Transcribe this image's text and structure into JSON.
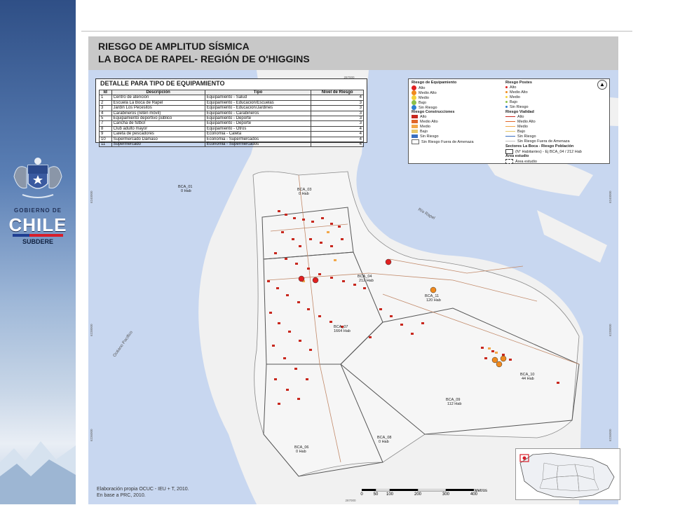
{
  "sidebar": {
    "brand_top": "GOBIERNO DE",
    "brand_main": "CHILE",
    "brand_sub": "SUBDERE"
  },
  "map": {
    "title_line1": "RIESGO DE AMPLITUD SÍSMICA",
    "title_line2": "LA BOCA DE RAPEL- REGIÓN DE O'HIGGINS",
    "coordinate_top": "287000",
    "coordinate_left_1": "6240000",
    "coordinate_left_2": "6238000",
    "coordinate_left_3": "6236000",
    "coordinate_right_1": "6240000",
    "coordinate_right_2": "6238000",
    "coordinate_right_3": "6236000",
    "coordinate_bottom": "287000",
    "water_label_ocean": "Océano Pacífico",
    "water_label_river": "Río Rapel",
    "sectors": [
      {
        "name": "BCA_01",
        "hab": "0 Hab"
      },
      {
        "name": "BCA_03",
        "hab": "0 Hab"
      },
      {
        "name": "BCA_04",
        "hab": "212 Hab"
      },
      {
        "name": "BCA_11",
        "hab": "120 Hab"
      },
      {
        "name": "BCA_07",
        "hab": "1664 Hab"
      },
      {
        "name": "BCA_10",
        "hab": "44 Hab"
      },
      {
        "name": "BCA_09",
        "hab": "112 Hab"
      },
      {
        "name": "BCA_08",
        "hab": "0 Hab"
      },
      {
        "name": "BCA_06",
        "hab": "0 Hab"
      }
    ],
    "credit_line1": "Elaboración propia OCUC - IEU + T, 2010.",
    "credit_line2": "En base a PRC, 2010.",
    "scale_unit": "Metros",
    "scale_ticks": [
      "0",
      "50",
      "100",
      "200",
      "300",
      "400"
    ]
  },
  "equip_table": {
    "title": "DETALLE PARA TIPO DE EQUIPAMIENTO",
    "headers": [
      "Id",
      "Descripción",
      "Tipo",
      "Nivel de Riesgo"
    ],
    "rows": [
      [
        "1",
        "Centro de atención",
        "Equipamiento - Salud",
        "4"
      ],
      [
        "2",
        "Escuela La Boca de Rapel",
        "Equipamiento - Educacion/Escuelas",
        "3"
      ],
      [
        "3",
        "Jardin Los Pecesitos",
        "Equipamiento - Educacion/Jardines",
        "3"
      ],
      [
        "4",
        "Carabineros (retén móvil)",
        "Equipamiento - Carabineros",
        "3"
      ],
      [
        "5",
        "Equipamiento deportivo público",
        "Equipamiento - Deporte",
        "3"
      ],
      [
        "7",
        "Cancha de fútbol",
        "Equipamiento - Deporte",
        "3"
      ],
      [
        "8",
        "Club adulto mayor",
        "Equipamiento - Otros",
        "4"
      ],
      [
        "9",
        "Caleta de pescadores",
        "Economia - Caleta",
        "4"
      ],
      [
        "10",
        "Supermercado Dámaso",
        "Economia - Supermercados",
        "4"
      ],
      [
        "11",
        "Supermercado",
        "Economia - Supermercados",
        "4"
      ]
    ]
  },
  "legend": {
    "equip_title": "Riesgo de Equipamiento",
    "equip_items": [
      {
        "label": "Alto",
        "color": "#e02020"
      },
      {
        "label": "Medio Alto",
        "color": "#f08a1e"
      },
      {
        "label": "Medio",
        "color": "#f3d23a"
      },
      {
        "label": "Bajo",
        "color": "#8cc04a"
      },
      {
        "label": "Sin Riesgo",
        "color": "#2f7fd0"
      }
    ],
    "constr_title": "Riesgo Construcciones",
    "constr_items": [
      {
        "label": "Alto",
        "color": "#c8281e"
      },
      {
        "label": "Medio Alto",
        "color": "#e0662a"
      },
      {
        "label": "Medio",
        "color": "#f2a84a"
      },
      {
        "label": "Bajo",
        "color": "#e6c86a"
      },
      {
        "label": "Sin Riesgo",
        "color": "#3b6fc0"
      },
      {
        "label": "Sin Riesgo Fuera de Amenaza",
        "color": "#ffffff"
      }
    ],
    "postes_title": "Riesgo Postes",
    "postes_items": [
      {
        "label": "Alto",
        "color": "#e02020"
      },
      {
        "label": "Medio Alto",
        "color": "#f08a1e"
      },
      {
        "label": "Medio",
        "color": "#f3d23a"
      },
      {
        "label": "Bajo",
        "color": "#8cc04a"
      },
      {
        "label": "Sin Riesgo",
        "color": "#2f7fd0"
      }
    ],
    "vialidad_title": "Riesgo Vialidad",
    "vialidad_items": [
      {
        "label": "Alto",
        "color": "#c8281e"
      },
      {
        "label": "Medio Alto",
        "color": "#e0662a"
      },
      {
        "label": "Medio",
        "color": "#f2a84a"
      },
      {
        "label": "Bajo",
        "color": "#e6c86a"
      },
      {
        "label": "Sin Riesgo",
        "color": "#3b6fc0"
      },
      {
        "label": "Sin Riesgo Fuera de Amenaza",
        "color": "#bbbbbb"
      }
    ],
    "sectores_title": "Sectores La Boca - Riesgo Población",
    "sectores_item": "(N° Habitantes) - Ej BCA_04 / 212 Hab",
    "area_title": "Área estudio",
    "area_item": "Área estudio"
  }
}
